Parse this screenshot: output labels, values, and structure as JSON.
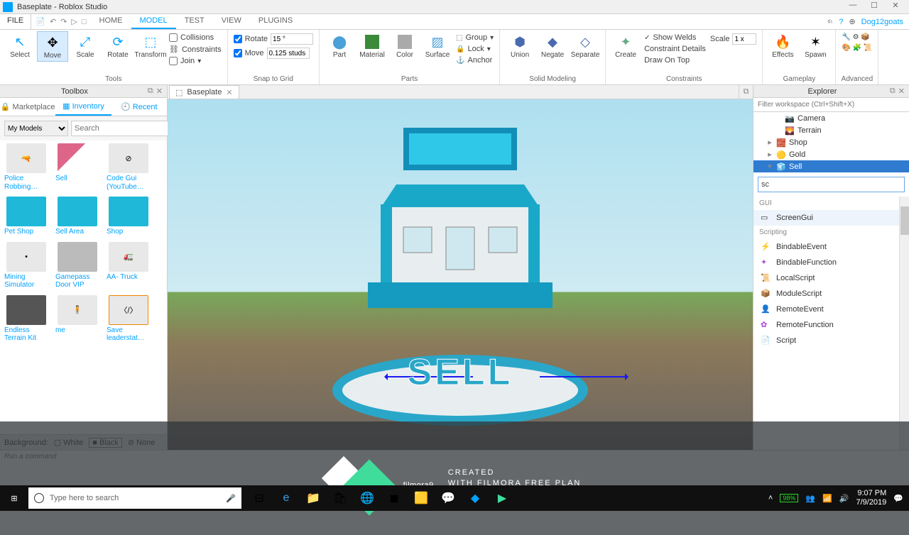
{
  "window": {
    "title": "Baseplate - Roblox Studio"
  },
  "ribbon": {
    "file": "FILE",
    "tabs": [
      "HOME",
      "MODEL",
      "TEST",
      "VIEW",
      "PLUGINS"
    ],
    "active_tab": "MODEL",
    "user": "Dog12goats",
    "tools": {
      "select": "Select",
      "move": "Move",
      "scale": "Scale",
      "rotate": "Rotate",
      "transform": "Transform",
      "collisions": "Collisions",
      "constraints": "Constraints",
      "join": "Join",
      "rotate_chk": "Rotate",
      "rotate_val": "15 °",
      "move_chk": "Move",
      "move_val": "0.125 studs",
      "part": "Part",
      "material": "Material",
      "color": "Color",
      "surface": "Surface",
      "group": "Group",
      "lock": "Lock",
      "anchor": "Anchor",
      "union": "Union",
      "negate": "Negate",
      "separate": "Separate",
      "create": "Create",
      "show_welds": "Show Welds",
      "c_details": "Constraint Details",
      "draw_top": "Draw On Top",
      "scale_lbl": "Scale",
      "scale_val": "1 x",
      "effects": "Effects",
      "spawn": "Spawn"
    },
    "groups": {
      "tools": "Tools",
      "snap": "Snap to Grid",
      "parts": "Parts",
      "solid": "Solid Modeling",
      "constraints": "Constraints",
      "gameplay": "Gameplay",
      "advanced": "Advanced"
    }
  },
  "toolbox": {
    "title": "Toolbox",
    "tabs": {
      "marketplace": "Marketplace",
      "inventory": "Inventory",
      "recent": "Recent"
    },
    "category": "My Models",
    "search_placeholder": "Search",
    "items": [
      "Police Robbing…",
      "Sell",
      "Code Gui (YouTube…",
      "Pet Shop",
      "Sell Area",
      "Shop",
      "Mining Simulator",
      "Gamepass Door VIP",
      "AA- Truck",
      "Endless Terrain Kit",
      "me",
      "Save leaderstat…"
    ],
    "bg_label": "Background:",
    "bg_white": "White",
    "bg_black": "Black",
    "bg_none": "None"
  },
  "doc_tab": {
    "icon": "⬚",
    "name": "Baseplate"
  },
  "scene": {
    "sell_text": "SELL"
  },
  "explorer": {
    "title": "Explorer",
    "filter_placeholder": "Filter workspace (Ctrl+Shift+X)",
    "tree": [
      {
        "name": "Camera",
        "icon": "📷"
      },
      {
        "name": "Terrain",
        "icon": "🌄"
      },
      {
        "name": "Shop",
        "icon": "🧱",
        "expand": "▸"
      },
      {
        "name": "Gold",
        "icon": "🟡",
        "expand": "▸"
      },
      {
        "name": "Sell",
        "icon": "🧊",
        "expand": "▾",
        "selected": true
      }
    ],
    "search_value": "sc",
    "cat_gui": "GUI",
    "screen_gui": "ScreenGui",
    "cat_scripting": "Scripting",
    "scripting_items": [
      "BindableEvent",
      "BindableFunction",
      "LocalScript",
      "ModuleScript",
      "RemoteEvent",
      "RemoteFunction",
      "Script"
    ]
  },
  "cmd_placeholder": "Run a command",
  "watermark": {
    "brand": "filmora",
    "nine": "9",
    "line1": "CREATED",
    "line2": "WITH FILMORA FREE PLAN"
  },
  "taskbar": {
    "search_placeholder": "Type here to search",
    "battery": "98%",
    "time": "9:07 PM",
    "date": "7/9/2019"
  }
}
